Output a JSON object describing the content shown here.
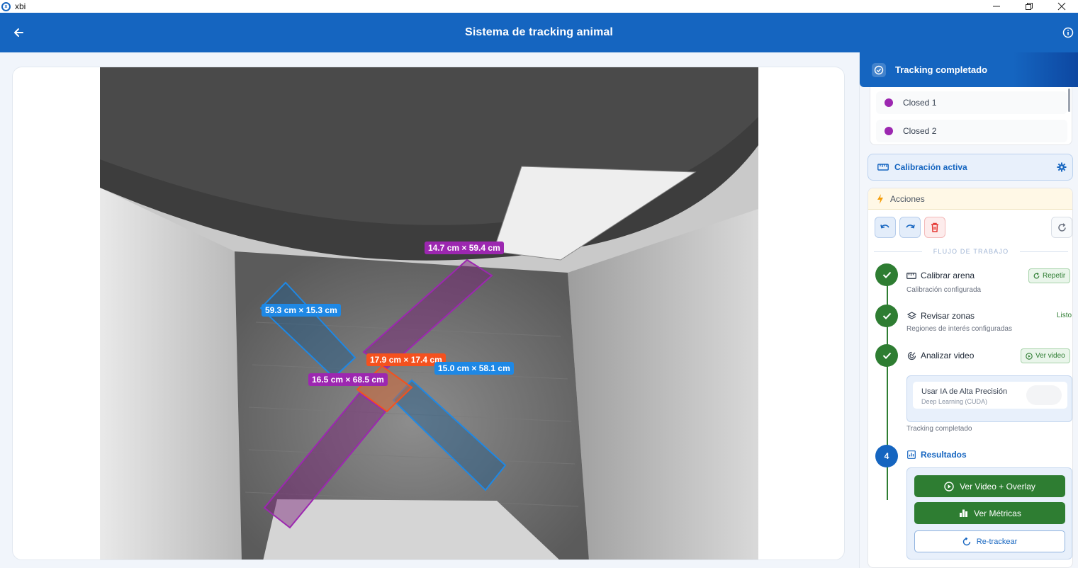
{
  "window": {
    "title": "xbi"
  },
  "appbar": {
    "title": "Sistema de tracking animal"
  },
  "video": {
    "labels": [
      {
        "text": "14.7 cm × 59.4 cm",
        "color": "#9c27b0"
      },
      {
        "text": "59.3 cm × 15.3 cm",
        "color": "#1e88e5"
      },
      {
        "text": "17.9 cm × 17.4 cm",
        "color": "#f4511e"
      },
      {
        "text": "15.0 cm × 58.1 cm",
        "color": "#1e88e5"
      },
      {
        "text": "16.5 cm × 68.5 cm",
        "color": "#9c27b0"
      }
    ]
  },
  "panel": {
    "status": "Tracking completado",
    "zones": [
      {
        "label": "Closed 1",
        "color": "#9c27b0"
      },
      {
        "label": "Closed 2",
        "color": "#9c27b0"
      }
    ],
    "calibration": "Calibración activa",
    "actions_title": "Acciones",
    "workflow_title": "FLUJO DE TRABAJO",
    "steps": [
      {
        "title": "Calibrar arena",
        "subtitle": "Calibración configurada",
        "action": "Repetir"
      },
      {
        "title": "Revisar zonas",
        "subtitle": "Regiones de interés configuradas",
        "action": "Listo"
      },
      {
        "title": "Analizar video",
        "subtitle": "Tracking completado",
        "action": "Ver video"
      },
      {
        "number": "4",
        "title": "Resultados"
      }
    ],
    "ai": {
      "title": "Usar IA de Alta Precisión",
      "subtitle": "Deep Learning (CUDA)",
      "enabled": false
    },
    "results_buttons": {
      "video_overlay": "Ver Video + Overlay",
      "metrics": "Ver Métricas",
      "retrack": "Re-trackear"
    }
  },
  "colors": {
    "primary": "#1565c0",
    "success": "#2e7d32",
    "danger": "#e53935",
    "zone_open": "#1e88e5",
    "zone_closed": "#9c27b0",
    "zone_center": "#f4511e"
  }
}
